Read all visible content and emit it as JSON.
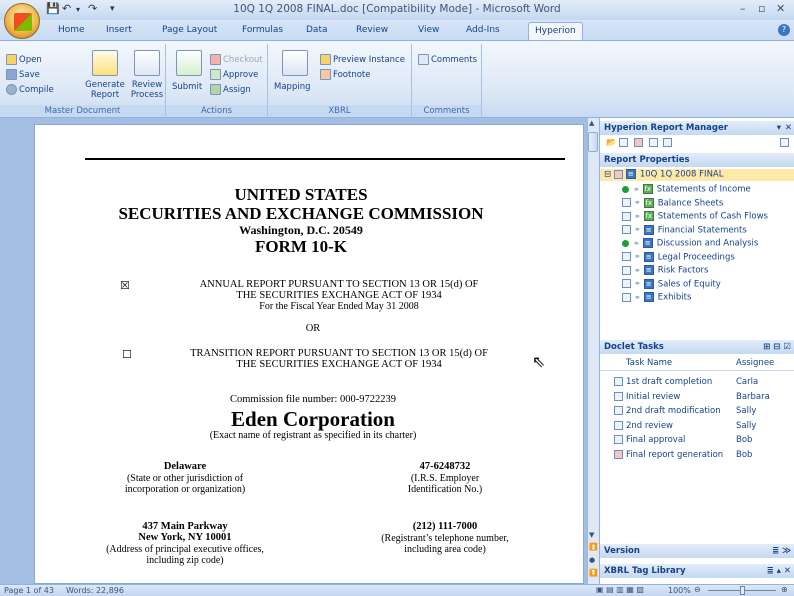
{
  "window": {
    "title": "10Q 1Q 2008 FINAL.doc [Compatibility Mode] - Microsoft Word"
  },
  "tabs": [
    "Home",
    "Insert",
    "Page Layout",
    "Formulas",
    "Data",
    "Review",
    "View",
    "Add-Ins",
    "Hyperion"
  ],
  "ribbon": {
    "master_document": {
      "label": "Master Document",
      "open": "Open",
      "save": "Save",
      "compile": "Compile",
      "generate_l1": "Generate",
      "generate_l2": "Report",
      "review_l1": "Review",
      "review_l2": "Process"
    },
    "actions": {
      "label": "Actions",
      "submit": "Submit",
      "checkout": "Checkout",
      "approve": "Approve",
      "assign": "Assign"
    },
    "xbrl": {
      "label": "XBRL",
      "mapping": "Mapping",
      "preview": "Preview Instance",
      "footnote": "Footnote"
    },
    "comments": {
      "label": "Comments",
      "comments": "Comments"
    }
  },
  "document": {
    "h1": "UNITED STATES",
    "h2": "SECURITIES AND EXCHANGE COMMISSION",
    "h3": "Washington, D.C. 20549",
    "h4": "FORM 10-K",
    "annual_l1": "ANNUAL REPORT PURSUANT TO SECTION 13 OR 15(d) OF",
    "annual_l2": "THE SECURITIES EXCHANGE ACT OF 1934",
    "annual_l3": "For the Fiscal Year Ended May 31 2008",
    "annual_mark": "☒",
    "or": "OR",
    "transition_l1": "TRANSITION REPORT PURSUANT TO SECTION 13 OR 15(d) OF",
    "transition_l2": "THE SECURITIES EXCHANGE ACT OF 1934",
    "transition_mark": "☐",
    "commission": "Commission file number: 000-9722239",
    "company": "Eden Corporation",
    "company_sub": "(Exact name of registrant as specified in its charter)",
    "state": "Delaware",
    "state_l1": "(State or other jurisdiction of",
    "state_l2": "incorporation or organization)",
    "irs": "47-6248732",
    "irs_l1": "(I.R.S. Employer",
    "irs_l2": "Identification No.)",
    "addr1": "437 Main Parkway",
    "addr2": "New York, NY 10001",
    "addr_l1": "(Address of principal executive offices,",
    "addr_l2": "including zip code)",
    "phone": "(212) 111-7000",
    "phone_l1": "(Registrant’s telephone number,",
    "phone_l2": "including area code)"
  },
  "panel": {
    "title": "Hyperion Report Manager",
    "report_properties": "Report Properties",
    "root": "10Q 1Q 2008 FINAL",
    "items": [
      {
        "label": "Statements of Income",
        "status": "green",
        "kind": "fx"
      },
      {
        "label": "Balance Sheets",
        "status": "check",
        "kind": "fx"
      },
      {
        "label": "Statements of Cash Flows",
        "status": "check",
        "kind": "fx"
      },
      {
        "label": "Financial Statements",
        "status": "check",
        "kind": "doc"
      },
      {
        "label": "Discussion and Analysis",
        "status": "green",
        "kind": "doc"
      },
      {
        "label": "Legal Proceedings",
        "status": "check",
        "kind": "doc"
      },
      {
        "label": "Risk Factors",
        "status": "check",
        "kind": "doc"
      },
      {
        "label": "Sales of Equity",
        "status": "check",
        "kind": "doc"
      },
      {
        "label": "Exhibits",
        "status": "check",
        "kind": "doc"
      }
    ],
    "doclet_tasks": "Doclet Tasks",
    "col_task": "Task Name",
    "col_assignee": "Assignee",
    "tasks": [
      {
        "name": "1st draft completion",
        "assignee": "Carla",
        "done": true
      },
      {
        "name": "Initial review",
        "assignee": "Barbara",
        "done": true
      },
      {
        "name": "2nd draft modification",
        "assignee": "Sally",
        "done": true
      },
      {
        "name": "2nd review",
        "assignee": "Sally",
        "done": true
      },
      {
        "name": "Final approval",
        "assignee": "Bob",
        "done": true
      },
      {
        "name": "Final report generation",
        "assignee": "Bob",
        "done": false
      }
    ],
    "version": "Version",
    "xbrl_tag_library": "XBRL Tag Library"
  },
  "status": {
    "page": "Page 1 of 43",
    "words": "Words: 22,896",
    "zoom": "100%"
  }
}
